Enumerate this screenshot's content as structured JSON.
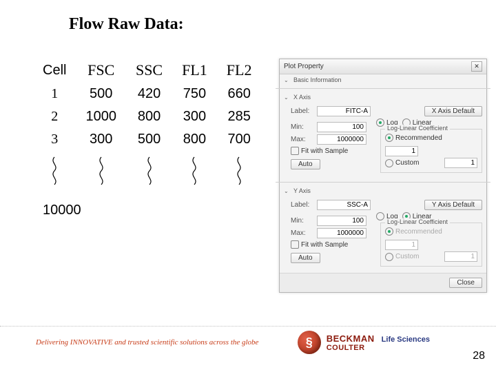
{
  "title": "Flow Raw Data:",
  "table": {
    "headers": [
      "Cell",
      "FSC",
      "SSC",
      "FL1",
      "FL2"
    ],
    "rows": [
      [
        "1",
        "500",
        "420",
        "750",
        "660"
      ],
      [
        "2",
        "1000",
        "800",
        "300",
        "285"
      ],
      [
        "3",
        "300",
        "500",
        "800",
        "700"
      ]
    ],
    "final_cell": "10000"
  },
  "dialog": {
    "title": "Plot Property",
    "close": "✕",
    "sections": {
      "basic": {
        "label": "Basic Information",
        "chevron": "⌄"
      },
      "xaxis": {
        "label": "X Axis",
        "chevron": "⌄",
        "default_btn": "X Axis Default",
        "label_field_label": "Label:",
        "label_value": "FITC-A",
        "min_label": "Min:",
        "min_value": "100",
        "max_label": "Max:",
        "max_value": "1000000",
        "log_label": "Log",
        "linear_label": "Linear",
        "scale_selected": "log",
        "coef_title": "Log-Linear Coefficient",
        "rec_label": "Recommended",
        "rec_value": "1",
        "custom_label": "Custom",
        "custom_value": "1",
        "coef_selected": "rec",
        "fit_label": "Fit with Sample",
        "fit_checked": false,
        "auto_btn": "Auto"
      },
      "yaxis": {
        "label": "Y Axis",
        "chevron": "⌄",
        "default_btn": "Y Axis Default",
        "label_field_label": "Label:",
        "label_value": "SSC-A",
        "min_label": "Min:",
        "min_value": "100",
        "max_label": "Max:",
        "max_value": "1000000",
        "log_label": "Log",
        "linear_label": "Linear",
        "scale_selected": "linear",
        "coef_title": "Log-Linear Coefficient",
        "rec_label": "Recommended",
        "rec_value": "1",
        "custom_label": "Custom",
        "custom_value": "1",
        "coef_selected": "rec",
        "fit_label": "Fit with Sample",
        "fit_checked": false,
        "auto_btn": "Auto"
      }
    },
    "close_btn": "Close"
  },
  "footer": {
    "tagline": "Delivering INNOVATIVE and trusted scientific solutions across the globe",
    "brand_main": "BECKMAN",
    "brand_coulter": "COULTER",
    "brand_sub": "Life Sciences"
  },
  "page_number": "28"
}
